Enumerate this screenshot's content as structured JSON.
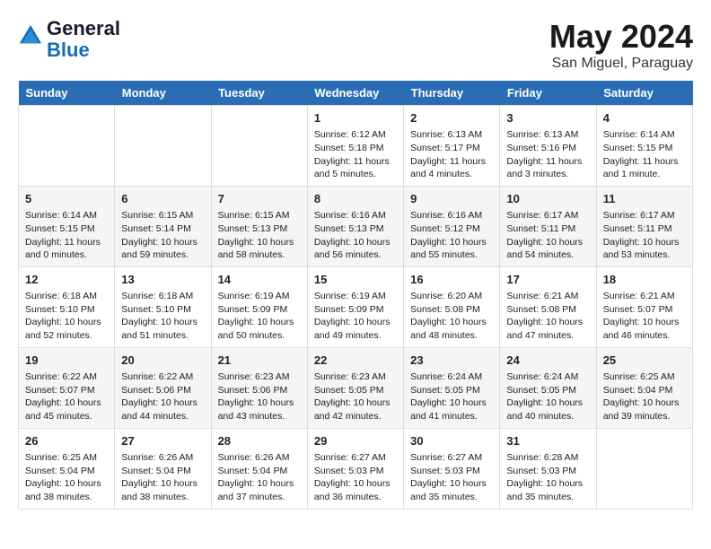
{
  "header": {
    "logo_line1": "General",
    "logo_line2": "Blue",
    "month_year": "May 2024",
    "location": "San Miguel, Paraguay"
  },
  "days_of_week": [
    "Sunday",
    "Monday",
    "Tuesday",
    "Wednesday",
    "Thursday",
    "Friday",
    "Saturday"
  ],
  "weeks": [
    [
      {
        "day": "",
        "content": ""
      },
      {
        "day": "",
        "content": ""
      },
      {
        "day": "",
        "content": ""
      },
      {
        "day": "1",
        "content": "Sunrise: 6:12 AM\nSunset: 5:18 PM\nDaylight: 11 hours\nand 5 minutes."
      },
      {
        "day": "2",
        "content": "Sunrise: 6:13 AM\nSunset: 5:17 PM\nDaylight: 11 hours\nand 4 minutes."
      },
      {
        "day": "3",
        "content": "Sunrise: 6:13 AM\nSunset: 5:16 PM\nDaylight: 11 hours\nand 3 minutes."
      },
      {
        "day": "4",
        "content": "Sunrise: 6:14 AM\nSunset: 5:15 PM\nDaylight: 11 hours\nand 1 minute."
      }
    ],
    [
      {
        "day": "5",
        "content": "Sunrise: 6:14 AM\nSunset: 5:15 PM\nDaylight: 11 hours\nand 0 minutes."
      },
      {
        "day": "6",
        "content": "Sunrise: 6:15 AM\nSunset: 5:14 PM\nDaylight: 10 hours\nand 59 minutes."
      },
      {
        "day": "7",
        "content": "Sunrise: 6:15 AM\nSunset: 5:13 PM\nDaylight: 10 hours\nand 58 minutes."
      },
      {
        "day": "8",
        "content": "Sunrise: 6:16 AM\nSunset: 5:13 PM\nDaylight: 10 hours\nand 56 minutes."
      },
      {
        "day": "9",
        "content": "Sunrise: 6:16 AM\nSunset: 5:12 PM\nDaylight: 10 hours\nand 55 minutes."
      },
      {
        "day": "10",
        "content": "Sunrise: 6:17 AM\nSunset: 5:11 PM\nDaylight: 10 hours\nand 54 minutes."
      },
      {
        "day": "11",
        "content": "Sunrise: 6:17 AM\nSunset: 5:11 PM\nDaylight: 10 hours\nand 53 minutes."
      }
    ],
    [
      {
        "day": "12",
        "content": "Sunrise: 6:18 AM\nSunset: 5:10 PM\nDaylight: 10 hours\nand 52 minutes."
      },
      {
        "day": "13",
        "content": "Sunrise: 6:18 AM\nSunset: 5:10 PM\nDaylight: 10 hours\nand 51 minutes."
      },
      {
        "day": "14",
        "content": "Sunrise: 6:19 AM\nSunset: 5:09 PM\nDaylight: 10 hours\nand 50 minutes."
      },
      {
        "day": "15",
        "content": "Sunrise: 6:19 AM\nSunset: 5:09 PM\nDaylight: 10 hours\nand 49 minutes."
      },
      {
        "day": "16",
        "content": "Sunrise: 6:20 AM\nSunset: 5:08 PM\nDaylight: 10 hours\nand 48 minutes."
      },
      {
        "day": "17",
        "content": "Sunrise: 6:21 AM\nSunset: 5:08 PM\nDaylight: 10 hours\nand 47 minutes."
      },
      {
        "day": "18",
        "content": "Sunrise: 6:21 AM\nSunset: 5:07 PM\nDaylight: 10 hours\nand 46 minutes."
      }
    ],
    [
      {
        "day": "19",
        "content": "Sunrise: 6:22 AM\nSunset: 5:07 PM\nDaylight: 10 hours\nand 45 minutes."
      },
      {
        "day": "20",
        "content": "Sunrise: 6:22 AM\nSunset: 5:06 PM\nDaylight: 10 hours\nand 44 minutes."
      },
      {
        "day": "21",
        "content": "Sunrise: 6:23 AM\nSunset: 5:06 PM\nDaylight: 10 hours\nand 43 minutes."
      },
      {
        "day": "22",
        "content": "Sunrise: 6:23 AM\nSunset: 5:05 PM\nDaylight: 10 hours\nand 42 minutes."
      },
      {
        "day": "23",
        "content": "Sunrise: 6:24 AM\nSunset: 5:05 PM\nDaylight: 10 hours\nand 41 minutes."
      },
      {
        "day": "24",
        "content": "Sunrise: 6:24 AM\nSunset: 5:05 PM\nDaylight: 10 hours\nand 40 minutes."
      },
      {
        "day": "25",
        "content": "Sunrise: 6:25 AM\nSunset: 5:04 PM\nDaylight: 10 hours\nand 39 minutes."
      }
    ],
    [
      {
        "day": "26",
        "content": "Sunrise: 6:25 AM\nSunset: 5:04 PM\nDaylight: 10 hours\nand 38 minutes."
      },
      {
        "day": "27",
        "content": "Sunrise: 6:26 AM\nSunset: 5:04 PM\nDaylight: 10 hours\nand 38 minutes."
      },
      {
        "day": "28",
        "content": "Sunrise: 6:26 AM\nSunset: 5:04 PM\nDaylight: 10 hours\nand 37 minutes."
      },
      {
        "day": "29",
        "content": "Sunrise: 6:27 AM\nSunset: 5:03 PM\nDaylight: 10 hours\nand 36 minutes."
      },
      {
        "day": "30",
        "content": "Sunrise: 6:27 AM\nSunset: 5:03 PM\nDaylight: 10 hours\nand 35 minutes."
      },
      {
        "day": "31",
        "content": "Sunrise: 6:28 AM\nSunset: 5:03 PM\nDaylight: 10 hours\nand 35 minutes."
      },
      {
        "day": "",
        "content": ""
      }
    ]
  ]
}
